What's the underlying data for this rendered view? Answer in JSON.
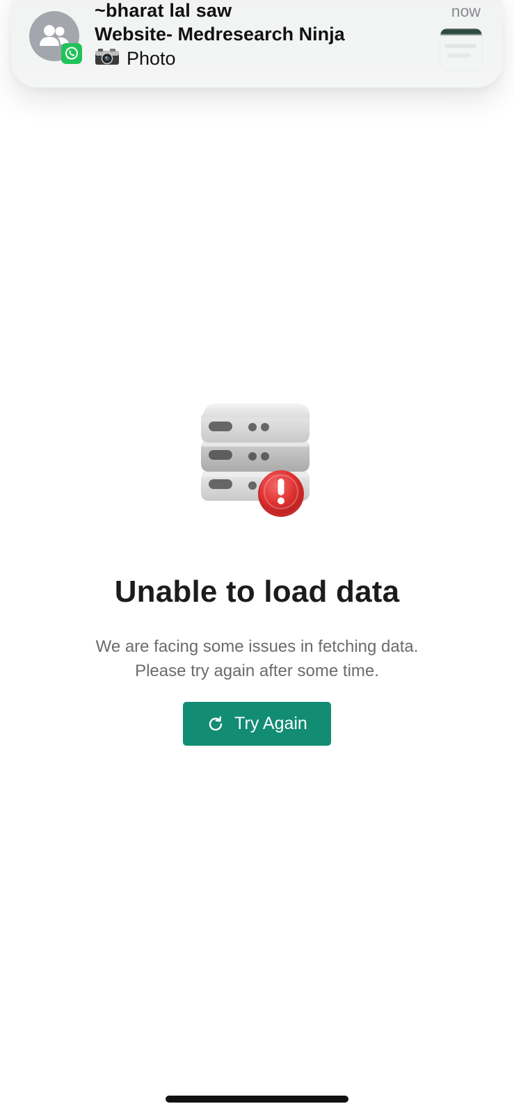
{
  "notification": {
    "sender": "~bharat lal saw",
    "title": "Website- Medresearch Ninja",
    "body": "Photo",
    "time": "now",
    "avatar_icon": "group-icon",
    "app_badge_icon": "whatsapp-icon",
    "attachment_icon": "camera-icon"
  },
  "error_state": {
    "illustration_icon": "server-error-icon",
    "title": "Unable to load data",
    "message_line1": "We are facing some issues in fetching data.",
    "message_line2": "Please try again after some time.",
    "retry_label": "Try Again",
    "retry_icon": "refresh-icon"
  },
  "colors": {
    "accent": "#128c73",
    "error_badge": "#e03131",
    "whatsapp_green": "#22c25a"
  }
}
